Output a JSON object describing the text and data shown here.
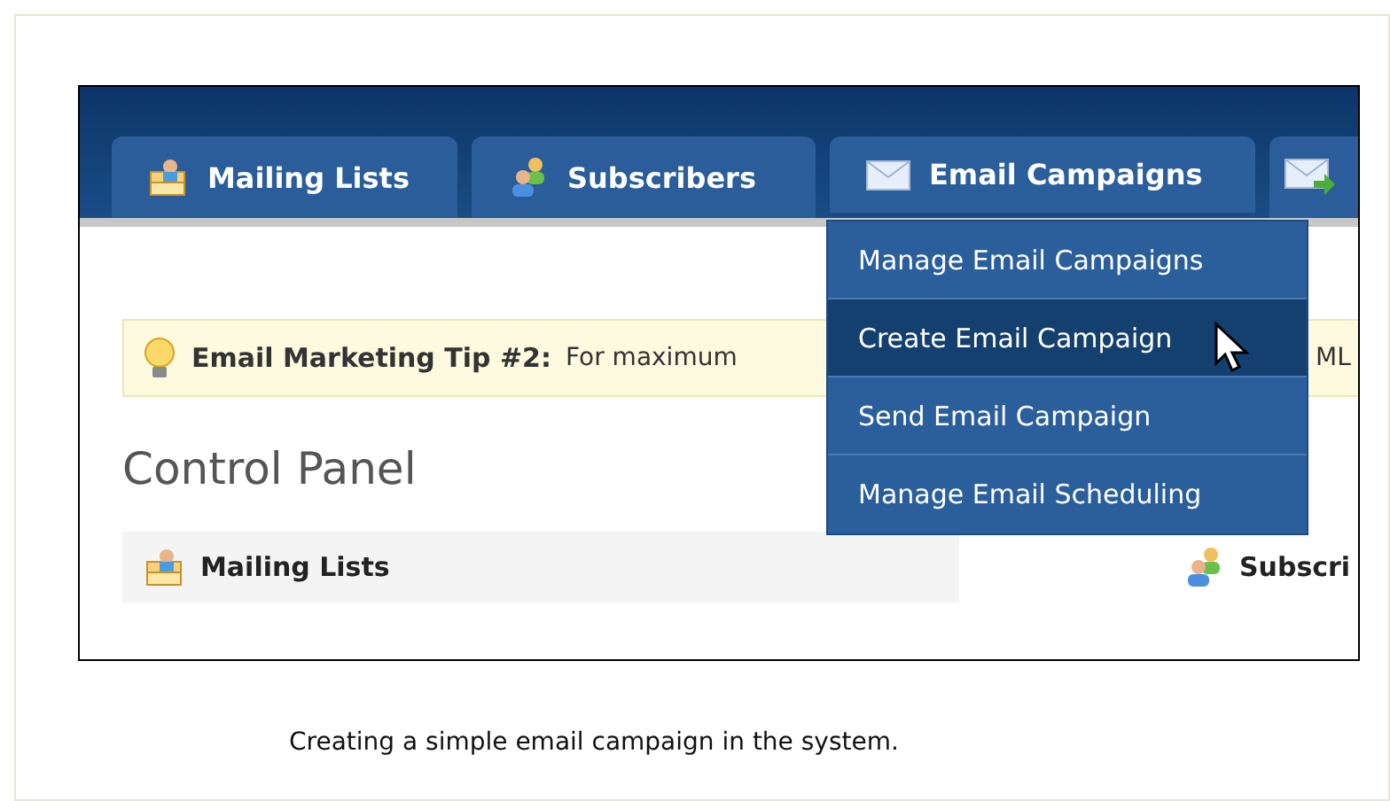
{
  "tabs": [
    {
      "label": "Mailing Lists",
      "kind": "lists",
      "open": false
    },
    {
      "label": "Subscribers",
      "kind": "people",
      "open": false
    },
    {
      "label": "Email Campaigns",
      "kind": "mail",
      "open": true
    },
    {
      "kind": "mail-send",
      "open": false
    }
  ],
  "menu": [
    {
      "label": "Manage Email Campaigns",
      "selected": false
    },
    {
      "label": "Create Email Campaign",
      "selected": true
    },
    {
      "label": "Send Email Campaign",
      "selected": false
    },
    {
      "label": "Manage Email Scheduling",
      "selected": false
    }
  ],
  "tip": {
    "title": "Email Marketing Tip #2:",
    "text_start": "For maximum",
    "text_end": "ML"
  },
  "heading": "Control Panel",
  "sections": [
    {
      "label": "Mailing Lists",
      "kind": "lists"
    },
    {
      "label": "Subscri",
      "kind": "people"
    }
  ],
  "caption": "Creating a simple email campaign in the system."
}
